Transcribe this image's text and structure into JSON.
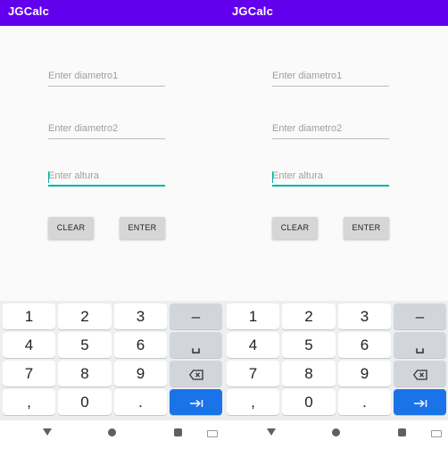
{
  "app": {
    "title": "JGCalc"
  },
  "form": {
    "diametro1_placeholder": "Enter diametro1",
    "diametro2_placeholder": "Enter diametro2",
    "altura_placeholder": "Enter altura",
    "clear_label": "CLEAR",
    "enter_label": "ENTER"
  },
  "keyboard": {
    "rows": [
      [
        "1",
        "2",
        "3",
        "–"
      ],
      [
        "4",
        "5",
        "6",
        "␣"
      ],
      [
        "7",
        "8",
        "9",
        "backspace-icon"
      ],
      [
        ",",
        "0",
        ".",
        "tab-next-icon"
      ]
    ],
    "action_color": "#1a73e8"
  },
  "navbar": {
    "icons": [
      "back-icon",
      "home-icon",
      "recents-icon",
      "keyboard-switch-icon"
    ]
  },
  "colors": {
    "appbar": "#6200ee",
    "focus_underline": "#00b3a4"
  }
}
